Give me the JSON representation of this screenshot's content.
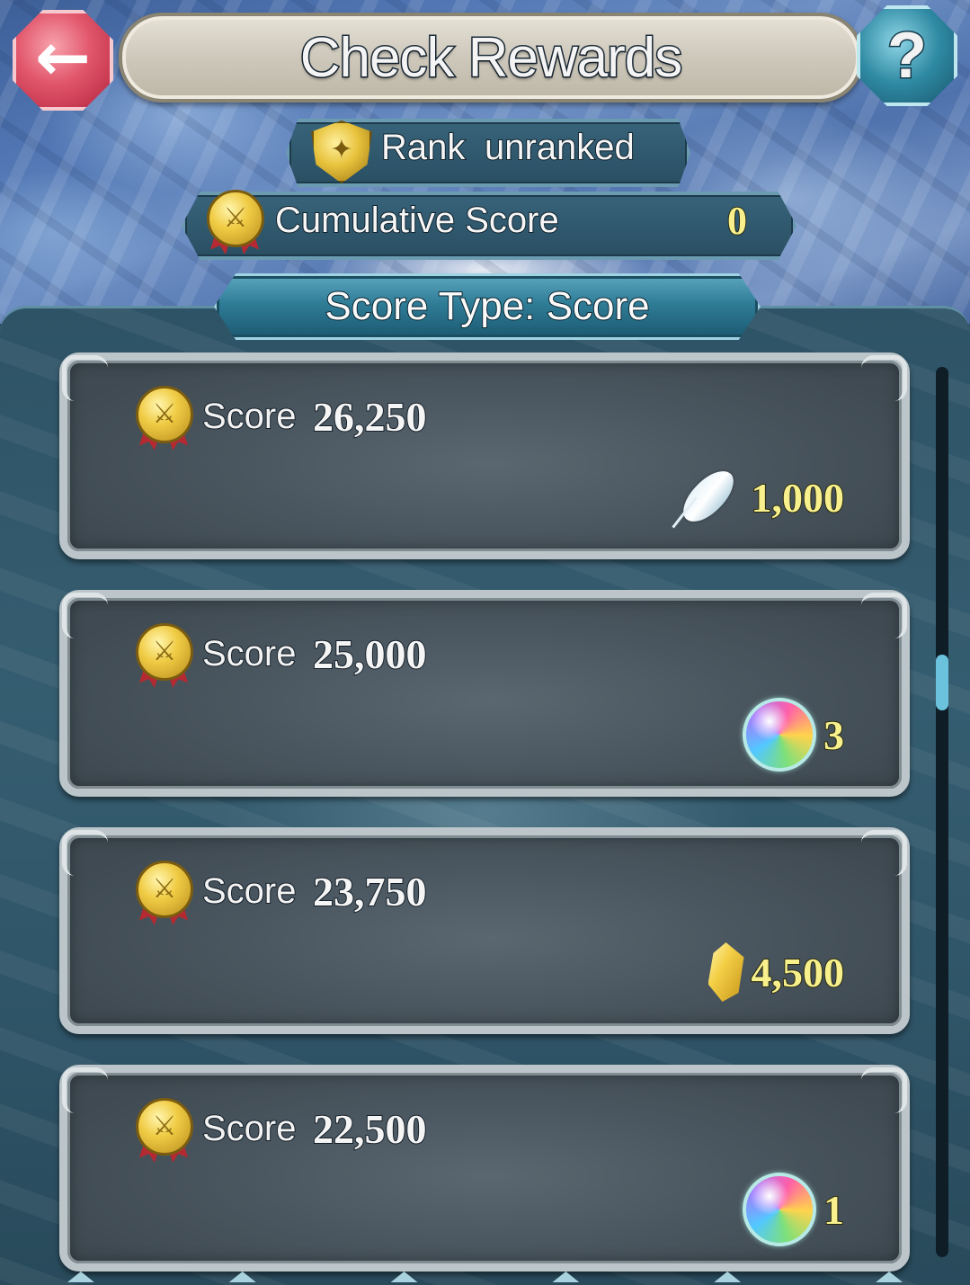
{
  "header": {
    "title": "Check Rewards",
    "back_icon": "back-arrow-icon",
    "help_label": "?"
  },
  "rank": {
    "label": "Rank",
    "value": "unranked"
  },
  "cumulative": {
    "label": "Cumulative Score",
    "value": "0"
  },
  "score_type": {
    "label": "Score Type: Score"
  },
  "rewards": [
    {
      "label": "Score",
      "score": "26,250",
      "reward_icon": "feather-icon",
      "quantity": "1,000"
    },
    {
      "label": "Score",
      "score": "25,000",
      "reward_icon": "orb-icon",
      "quantity": "3"
    },
    {
      "label": "Score",
      "score": "23,750",
      "reward_icon": "crystal-icon",
      "quantity": "4,500"
    },
    {
      "label": "Score",
      "score": "22,500",
      "reward_icon": "orb-icon",
      "quantity": "1"
    }
  ],
  "colors": {
    "accent_gold": "#f7f08c",
    "back_button": "#e2566b",
    "help_button": "#2f8aa3"
  }
}
